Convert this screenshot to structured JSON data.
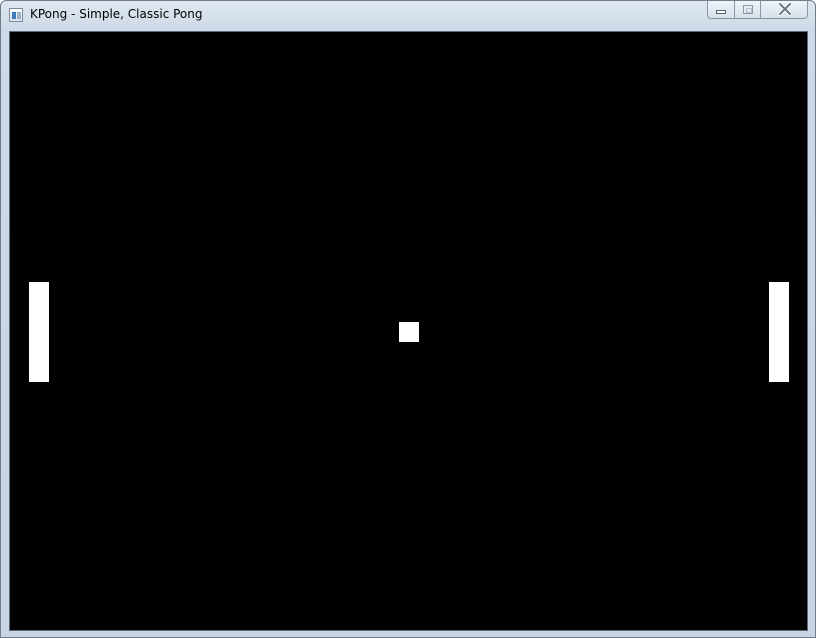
{
  "window": {
    "title": "KPong - Simple, Classic Pong",
    "icon": "kpong-app-icon"
  },
  "caption_buttons": {
    "minimize_icon": "minimize-icon",
    "maximize_icon": "maximize-icon",
    "close_icon": "close-icon"
  },
  "game": {
    "background_color": "#000000",
    "foreground_color": "#ffffff"
  }
}
